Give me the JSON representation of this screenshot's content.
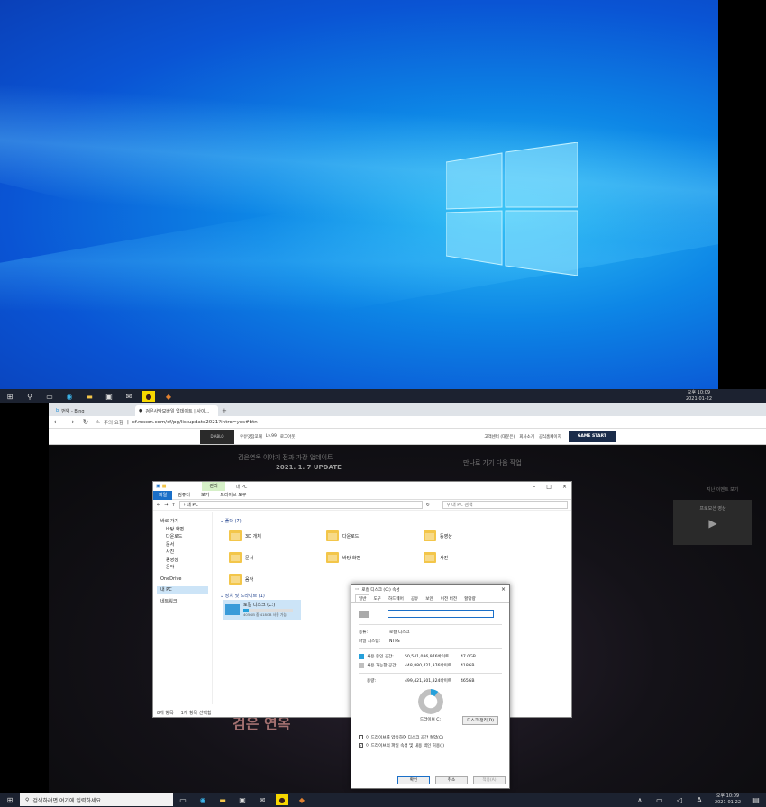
{
  "screen1": {
    "taskbar": {
      "icons": [
        "windows-logo",
        "search",
        "task-view",
        "edge",
        "file-explorer",
        "store",
        "mail",
        "kakaotalk",
        "game"
      ],
      "clock_period": "오후 10:09",
      "clock_date": "2021-01-22"
    }
  },
  "screen2": {
    "browser": {
      "tabs": [
        {
          "label": "번역 - Bing"
        },
        {
          "label": "검은사막모바일 업데이트 | 사이..."
        }
      ],
      "url_warning": "주의 요함",
      "url": "cf.nexon.com/cf/pg/listupdate2021?intro=yes#btn",
      "site": {
        "logo": "DIABLO",
        "user": "우유맛잠꼬대",
        "user_level": "Lv.99",
        "logout": "로그아웃",
        "links": [
          "고객센터 (대문은)",
          "회사소개",
          "공식홈페이지"
        ],
        "game_start": "GAME START",
        "banner_title": "검은연옥 이야기 전과 가장 업데이트",
        "banner_date": "2021. 1. 7 UPDATE",
        "banner_right": "만나로 가기 다음 작업",
        "big_text": "검은 연옥",
        "promo": "프로모션 영상",
        "side_note": "지난 이벤트 보기"
      }
    },
    "explorer": {
      "ribbon_context": "관리",
      "title": "내 PC",
      "ribbon_tabs": [
        "파일",
        "컴퓨터",
        "보기",
        "드라이브 도구"
      ],
      "path": "내 PC",
      "search_placeholder": "내 PC 검색",
      "sidebar": [
        "바로 가기",
        "바탕 화면",
        "다운로드",
        "문서",
        "사진",
        "동영상",
        "음악",
        "OneDrive",
        "내 PC",
        "네트워크"
      ],
      "folders_header": "폴더 (7)",
      "folders": [
        "3D 개체",
        "다운로드",
        "동영상",
        "문서",
        "바탕 화면",
        "사진",
        "음악"
      ],
      "devices_header": "장치 및 드라이브 (1)",
      "drive_name": "로컬 디스크 (C:)",
      "drive_space": "405GB 중 418GB 사용 가능",
      "drive_fill_fraction": 0.1,
      "status_items": "8개 항목",
      "status_selected": "1개 항목 선택함"
    },
    "properties": {
      "title": "로컬 디스크 (C:) 속성",
      "tabs": [
        "일반",
        "도구",
        "하드웨어",
        "공유",
        "보안",
        "이전 버전",
        "할당량"
      ],
      "type_label": "종류:",
      "type_value": "로컬 디스크",
      "fs_label": "파일 시스템:",
      "fs_value": "NTFS",
      "used_label": "사용 중인 공간:",
      "used_bytes": "50,541,086,976바이트",
      "used_gb": "47.0GB",
      "free_label": "사용 가능한 공간:",
      "free_bytes": "448,880,421,376바이트",
      "free_gb": "418GB",
      "capacity_label": "용량:",
      "capacity_bytes": "499,421,501,824바이트",
      "capacity_gb": "465GB",
      "drive_label": "드라이브 C:",
      "cleanup": "디스크 정리(D)",
      "check1": "이 드라이브를 압축하여 디스크 공간 절약(C)",
      "check2": "이 드라이브의 파일 속성 및 내용 색인 허용(I)",
      "ok": "확인",
      "cancel": "취소",
      "apply": "적용(A)",
      "used_fraction": 0.1,
      "colors": {
        "used": "#26a0da",
        "free": "#c0c0c0"
      }
    },
    "taskbar": {
      "search_placeholder": "검색하려면 여기에 입력하세요.",
      "clock_period": "오후 10:09",
      "clock_date": "2021-01-22",
      "ime": "A"
    }
  }
}
